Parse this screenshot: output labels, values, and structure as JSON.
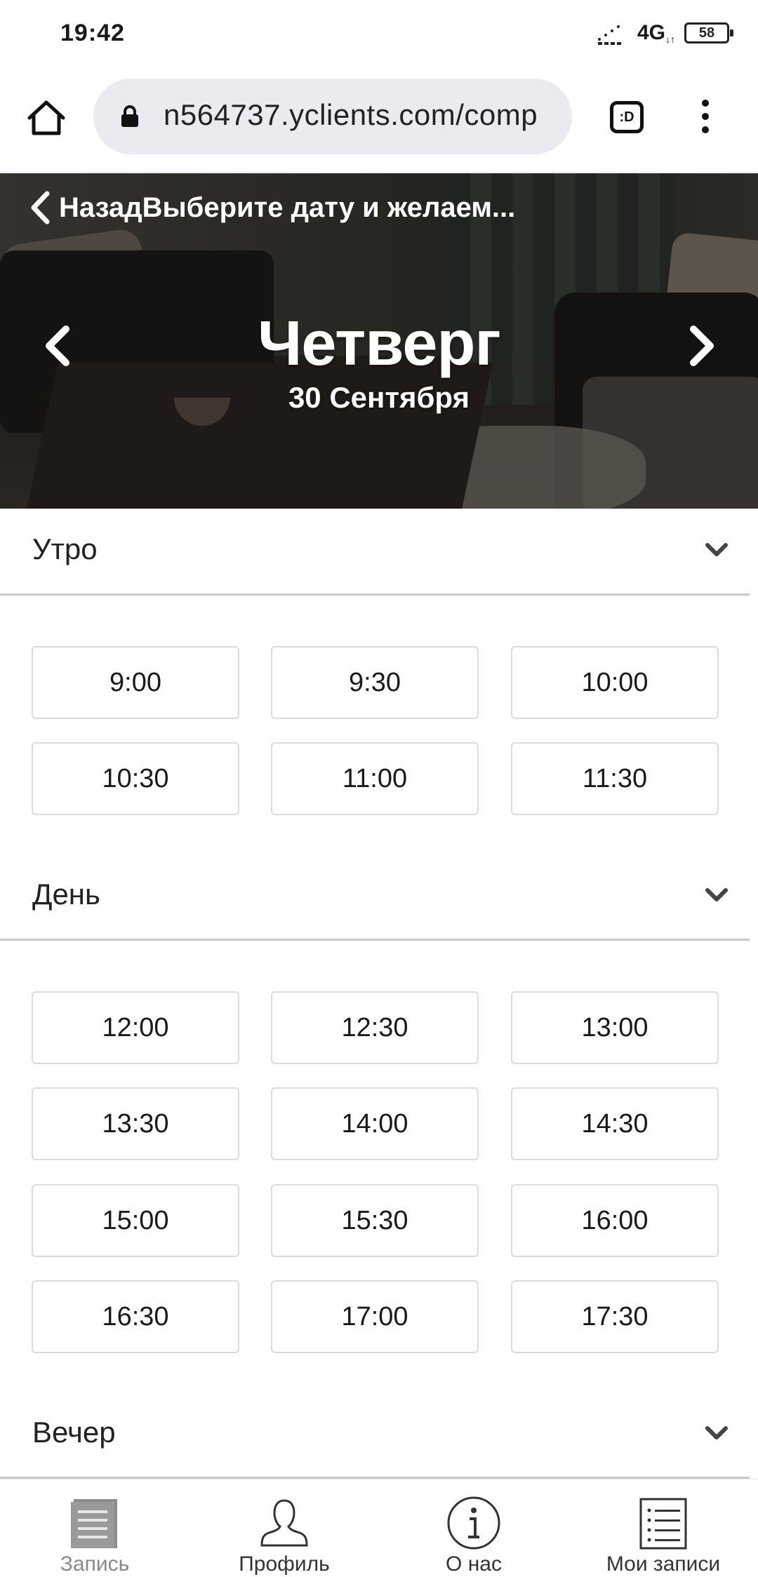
{
  "status_bar": {
    "time": "19:42",
    "network": "4G",
    "battery": "58"
  },
  "browser": {
    "url": "n564737.yclients.com/comp",
    "tab_label": ":D"
  },
  "header": {
    "back_label": "Назад",
    "page_title": "Выберите дату и желаем...",
    "day_name": "Четверг",
    "date": "30 Сентября"
  },
  "sections": {
    "morning": {
      "title": "Утро",
      "slots": [
        "9:00",
        "9:30",
        "10:00",
        "10:30",
        "11:00",
        "11:30"
      ]
    },
    "day": {
      "title": "День",
      "slots": [
        "12:00",
        "12:30",
        "13:00",
        "13:30",
        "14:00",
        "14:30",
        "15:00",
        "15:30",
        "16:00",
        "16:30",
        "17:00",
        "17:30"
      ]
    },
    "evening": {
      "title": "Вечер"
    }
  },
  "bottom_nav": [
    {
      "label": "Запись",
      "icon": "booking-icon",
      "active": true
    },
    {
      "label": "Профиль",
      "icon": "profile-icon",
      "active": false
    },
    {
      "label": "О нас",
      "icon": "info-icon",
      "active": false
    },
    {
      "label": "Мои записи",
      "icon": "list-icon",
      "active": false
    }
  ]
}
